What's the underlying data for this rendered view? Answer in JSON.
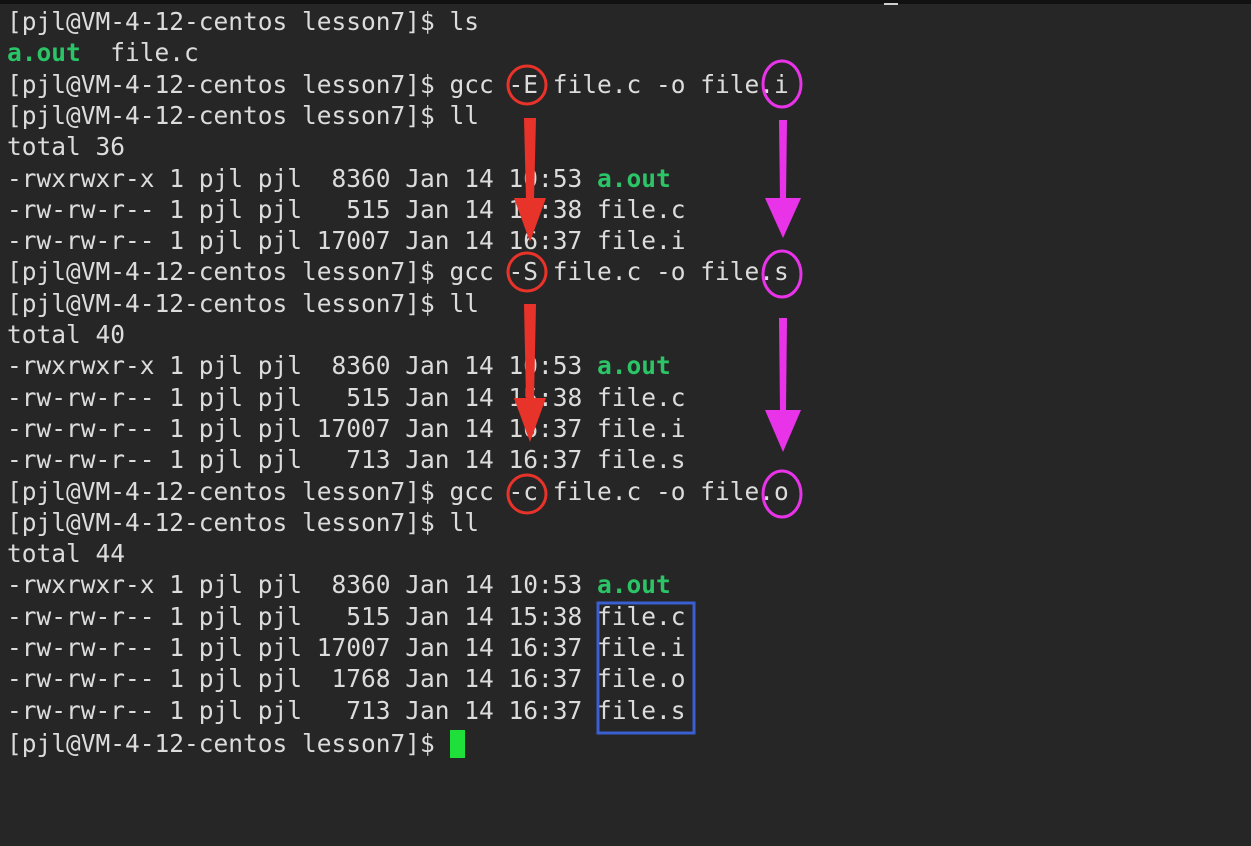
{
  "terminal": {
    "prompt": "[pjl@VM-4-12-centos lesson7]$ ",
    "lines": [
      [
        {
          "t": "[pjl@VM-4-12-centos lesson7]$ ls"
        }
      ],
      [
        {
          "t": "a.out",
          "c": "green"
        },
        {
          "t": "  file.c"
        }
      ],
      [
        {
          "t": "[pjl@VM-4-12-centos lesson7]$ gcc -E file.c -o file.i"
        }
      ],
      [
        {
          "t": "[pjl@VM-4-12-centos lesson7]$ ll"
        }
      ],
      [
        {
          "t": "total 36"
        }
      ],
      [
        {
          "t": "-rwxrwxr-x 1 pjl pjl  8360 Jan 14 10:53 "
        },
        {
          "t": "a.out",
          "c": "green"
        }
      ],
      [
        {
          "t": "-rw-rw-r-- 1 pjl pjl   515 Jan 14 15:38 file.c"
        }
      ],
      [
        {
          "t": "-rw-rw-r-- 1 pjl pjl 17007 Jan 14 16:37 file.i"
        }
      ],
      [
        {
          "t": "[pjl@VM-4-12-centos lesson7]$ gcc -S file.c -o file.s"
        }
      ],
      [
        {
          "t": "[pjl@VM-4-12-centos lesson7]$ ll"
        }
      ],
      [
        {
          "t": "total 40"
        }
      ],
      [
        {
          "t": "-rwxrwxr-x 1 pjl pjl  8360 Jan 14 10:53 "
        },
        {
          "t": "a.out",
          "c": "green"
        }
      ],
      [
        {
          "t": "-rw-rw-r-- 1 pjl pjl   515 Jan 14 15:38 file.c"
        }
      ],
      [
        {
          "t": "-rw-rw-r-- 1 pjl pjl 17007 Jan 14 16:37 file.i"
        }
      ],
      [
        {
          "t": "-rw-rw-r-- 1 pjl pjl   713 Jan 14 16:37 file.s"
        }
      ],
      [
        {
          "t": "[pjl@VM-4-12-centos lesson7]$ gcc -c file.c -o file.o"
        }
      ],
      [
        {
          "t": "[pjl@VM-4-12-centos lesson7]$ ll"
        }
      ],
      [
        {
          "t": "total 44"
        }
      ],
      [
        {
          "t": "-rwxrwxr-x 1 pjl pjl  8360 Jan 14 10:53 "
        },
        {
          "t": "a.out",
          "c": "green"
        }
      ],
      [
        {
          "t": "-rw-rw-r-- 1 pjl pjl   515 Jan 14 15:38 file.c"
        }
      ],
      [
        {
          "t": "-rw-rw-r-- 1 pjl pjl 17007 Jan 14 16:37 file.i"
        }
      ],
      [
        {
          "t": "-rw-rw-r-- 1 pjl pjl  1768 Jan 14 16:37 file.o"
        }
      ],
      [
        {
          "t": "-rw-rw-r-- 1 pjl pjl   713 Jan 14 16:37 file.s"
        }
      ]
    ]
  },
  "colors": {
    "background": "#262626",
    "text": "#dcdcdc",
    "executable_green": "#2bc466",
    "cursor_green": "#1fe03a",
    "annotation_red": "#e8332a",
    "annotation_magenta": "#e833e8",
    "annotation_blue": "#3a5fd0"
  },
  "annotations": {
    "red_circles": [
      "gcc -E option",
      "gcc -S option",
      "gcc -c option"
    ],
    "magenta_circles": [
      "suffix .i",
      "suffix .s",
      "suffix .o"
    ],
    "blue_box": "file.c file.i file.o file.s"
  }
}
